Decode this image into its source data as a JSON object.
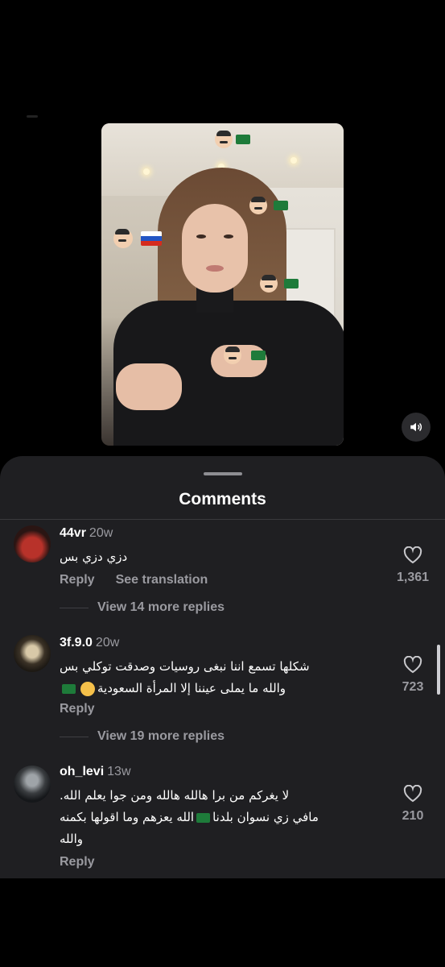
{
  "sheet": {
    "title": "Comments"
  },
  "comments": [
    {
      "user": "44vr",
      "time": "20w",
      "text": "دزي دزي بس",
      "reply_label": "Reply",
      "translate_label": "See translation",
      "likes": "1,361",
      "more_replies": "View 14 more replies"
    },
    {
      "user": "3f.9.0",
      "time": "20w",
      "text_line1": "شكلها تسمع اننا نبغى روسيات وصدقت توكلي بس",
      "text_line2": "والله ما يملى عيننا إلا المرأة السعودية",
      "reply_label": "Reply",
      "likes": "723",
      "more_replies": "View 19 more replies"
    },
    {
      "user": "oh_levi",
      "time": "13w",
      "text_line1": "لا يغركم من برا هالله هالله ومن جوا يعلم الله.",
      "text_line2a": "مافي زي نسوان بلدنا",
      "text_line2b": "الله يعزهم وما اقولها بكمنه",
      "text_line3": "والله",
      "reply_label": "Reply",
      "likes": "210"
    }
  ],
  "icons": {
    "sound": "speaker-icon",
    "like": "heart-icon",
    "stickers": [
      "man-emoji",
      "saudi-flag",
      "russia-flag"
    ]
  },
  "colors": {
    "sheet_bg": "#1f1f22",
    "secondary_text": "#9a9aa0",
    "saudi_green": "#1e7b3a"
  }
}
